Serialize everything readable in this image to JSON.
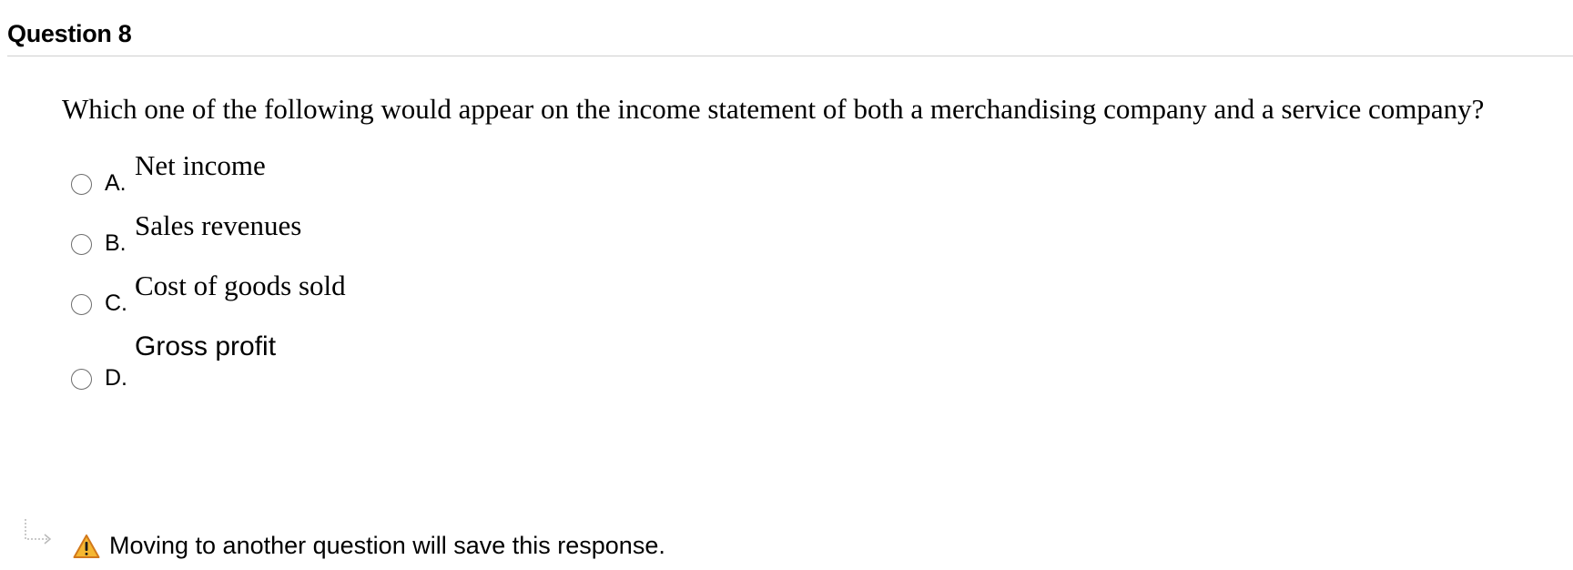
{
  "question": {
    "header": "Question 8",
    "prompt": "Which one of the following would appear on the income statement of both a merchandising company and a service company?"
  },
  "options": [
    {
      "letter": "A.",
      "text": "Net income",
      "selected": false
    },
    {
      "letter": "B.",
      "text": "Sales revenues",
      "selected": false
    },
    {
      "letter": "C.",
      "text": "Cost of goods sold",
      "selected": false
    },
    {
      "letter": "D.",
      "text": "Gross profit",
      "selected": false
    }
  ],
  "footer": {
    "notice": "Moving to another question will save this response.",
    "icon": "warning-icon",
    "warning_color": "#f0a030"
  }
}
